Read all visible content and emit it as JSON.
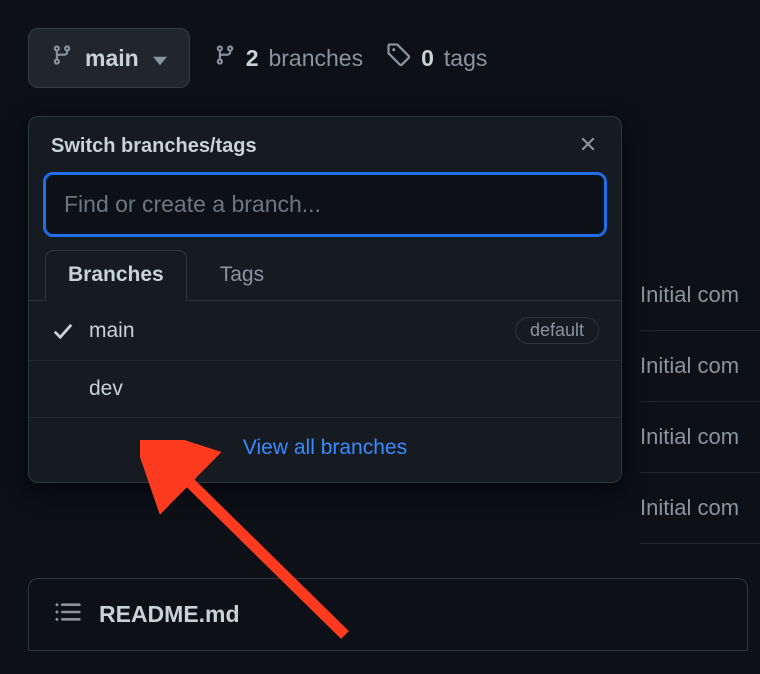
{
  "topbar": {
    "branch_button_label": "main",
    "branches_count": "2",
    "branches_label": "branches",
    "tags_count": "0",
    "tags_label": "tags"
  },
  "dropdown": {
    "title": "Switch branches/tags",
    "search_placeholder": "Find or create a branch...",
    "tabs": {
      "branches": "Branches",
      "tags": "Tags"
    },
    "items": [
      {
        "name": "main",
        "checked": true,
        "default_label": "default"
      },
      {
        "name": "dev",
        "checked": false
      }
    ],
    "view_all": "View all branches"
  },
  "background_rows": {
    "r0": "Initial com",
    "r1": "Initial com",
    "r2": "Initial com",
    "r3": "Initial com"
  },
  "readme": {
    "filename": "README.md"
  }
}
